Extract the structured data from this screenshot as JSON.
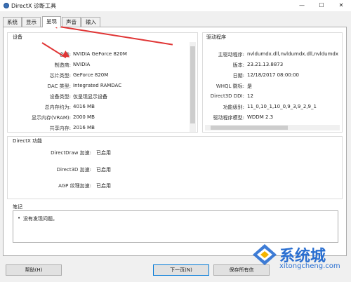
{
  "window": {
    "title": "DirectX 诊断工具",
    "minimize": "—",
    "maximize": "☐",
    "close": "✕"
  },
  "tabs": [
    {
      "label": "系统"
    },
    {
      "label": "显示"
    },
    {
      "label": "呈现"
    },
    {
      "label": "声音"
    },
    {
      "label": "输入"
    }
  ],
  "device": {
    "group_label": "设备",
    "rows": [
      {
        "label": "名称:",
        "value": "NVIDIA GeForce 820M"
      },
      {
        "label": "制造商:",
        "value": "NVIDIA"
      },
      {
        "label": "芯片类型:",
        "value": "GeForce 820M"
      },
      {
        "label": "DAC 类型:",
        "value": "Integrated RAMDAC"
      },
      {
        "label": "设备类型:",
        "value": "仅呈现显示设备"
      },
      {
        "label": "总内存约为:",
        "value": "4016 MB"
      },
      {
        "label": "显示内存(VRAM):",
        "value": "2000 MB"
      },
      {
        "label": "共享内存:",
        "value": "2016 MB"
      }
    ]
  },
  "drivers": {
    "group_label": "驱动程序",
    "rows": [
      {
        "label": "主驱动程序:",
        "value": "nvldumdx.dll,nvldumdx.dll,nvldumdx.d"
      },
      {
        "label": "版本:",
        "value": "23.21.13.8873"
      },
      {
        "label": "日期:",
        "value": "12/18/2017 08:00:00"
      },
      {
        "label": "WHQL 徽标:",
        "value": "是"
      },
      {
        "label": "Direct3D DDI:",
        "value": "12"
      },
      {
        "label": "功能级别:",
        "value": "11_0,10_1,10_0,9_3,9_2,9_1"
      },
      {
        "label": "驱动程序模型:",
        "value": "WDDM 2.3"
      }
    ]
  },
  "directx_features": {
    "group_label": "DirectX 功能",
    "rows": [
      {
        "label": "DirectDraw 加速:",
        "value": "已启用"
      },
      {
        "label": "Direct3D 加速:",
        "value": "已启用"
      },
      {
        "label": "AGP 纹理加速:",
        "value": "已启用"
      }
    ]
  },
  "notes": {
    "group_label": "笔记",
    "items": [
      "没有发现问题。"
    ]
  },
  "buttons": {
    "help": "帮助(H)",
    "next": "下一页(N)",
    "save": "保存所有信"
  },
  "watermark": {
    "brand": "系统城",
    "url": "xitongcheng.com"
  },
  "colors": {
    "accent": "#0078d7",
    "annotation_arrow": "#e03535",
    "watermark": "#2a6fd1"
  }
}
